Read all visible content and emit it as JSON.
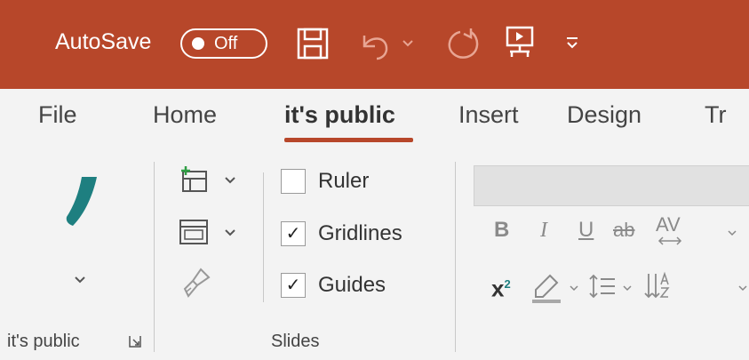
{
  "titlebar": {
    "autosave_label": "AutoSave",
    "autosave_state": "Off",
    "background": "#b7472a",
    "icons": [
      "save-icon",
      "undo-icon",
      "chevron-down-icon",
      "redo-icon",
      "present-icon",
      "customize-icon"
    ]
  },
  "tabs": [
    {
      "label": "File"
    },
    {
      "label": "Home"
    },
    {
      "label": "it's public",
      "active": true
    },
    {
      "label": "Insert"
    },
    {
      "label": "Design"
    },
    {
      "label": "Tr"
    }
  ],
  "ribbon": {
    "group1": {
      "label": "it's public",
      "icons": [
        "pen-icon",
        "chevron-down-icon",
        "dialog-launcher-icon"
      ]
    },
    "group2": {
      "label": "Slides",
      "icons": [
        "new-slide-icon",
        "layout-icon",
        "format-painter-icon"
      ],
      "checkboxes": [
        {
          "label": "Ruler",
          "checked": false
        },
        {
          "label": "Gridlines",
          "checked": true
        },
        {
          "label": "Guides",
          "checked": true
        }
      ]
    },
    "font_group": {
      "bold": "B",
      "italic": "I",
      "underline": "U",
      "strike": "ab",
      "spacing": "AV",
      "superscript_x": "x",
      "superscript_2": "2"
    }
  },
  "colors": {
    "accent": "#b7472a",
    "teal": "#1e7f80"
  }
}
